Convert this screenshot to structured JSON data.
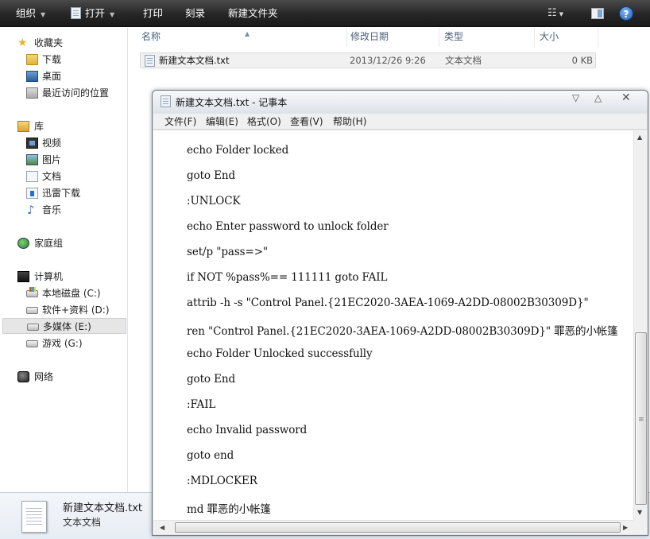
{
  "toolbar": {
    "organize": "组织",
    "open": "打开",
    "print": "打印",
    "burn": "刻录",
    "new_folder": "新建文件夹",
    "help": "?"
  },
  "nav": {
    "favorites": "收藏夹",
    "downloads": "下载",
    "desktop": "桌面",
    "recent": "最近访问的位置",
    "libraries": "库",
    "videos": "视频",
    "pictures": "图片",
    "documents": "文档",
    "xunlei": "迅雷下载",
    "music": "音乐",
    "homegroup": "家庭组",
    "computer": "计算机",
    "drive_c": "本地磁盘 (C:)",
    "drive_d": "软件+资料 (D:)",
    "drive_e": "多媒体 (E:)",
    "drive_g": "游戏 (G:)",
    "network": "网络"
  },
  "filelist": {
    "columns": [
      "名称",
      "修改日期",
      "类型",
      "大小"
    ],
    "file": {
      "name": "新建文本文档.txt",
      "modified": "2013/12/26 9:26",
      "type": "文本文档",
      "size": "0 KB"
    }
  },
  "details": {
    "name": "新建文本文档.txt",
    "type": "文本文档"
  },
  "notepad": {
    "title": "新建文本文档.txt - 记事本",
    "menu": [
      "文件(F)",
      "编辑(E)",
      "格式(O)",
      "查看(V)",
      "帮助(H)"
    ],
    "lines": [
      "echo Folder locked",
      "goto End",
      ":UNLOCK",
      "echo Enter password to unlock folder",
      "set/p \"pass=>\"",
      "if NOT %pass%== 111111 goto FAIL",
      "attrib -h -s \"Control Panel.{21EC2020-3AEA-1069-A2DD-08002B30309D}\"",
      "ren \"Control Panel.{21EC2020-3AEA-1069-A2DD-08002B30309D}\" 罪恶的小帐篷",
      "echo Folder Unlocked successfully",
      "goto End",
      ":FAIL",
      "echo Invalid password",
      "goto end",
      ":MDLOCKER",
      "md 罪恶的小帐篷"
    ]
  }
}
